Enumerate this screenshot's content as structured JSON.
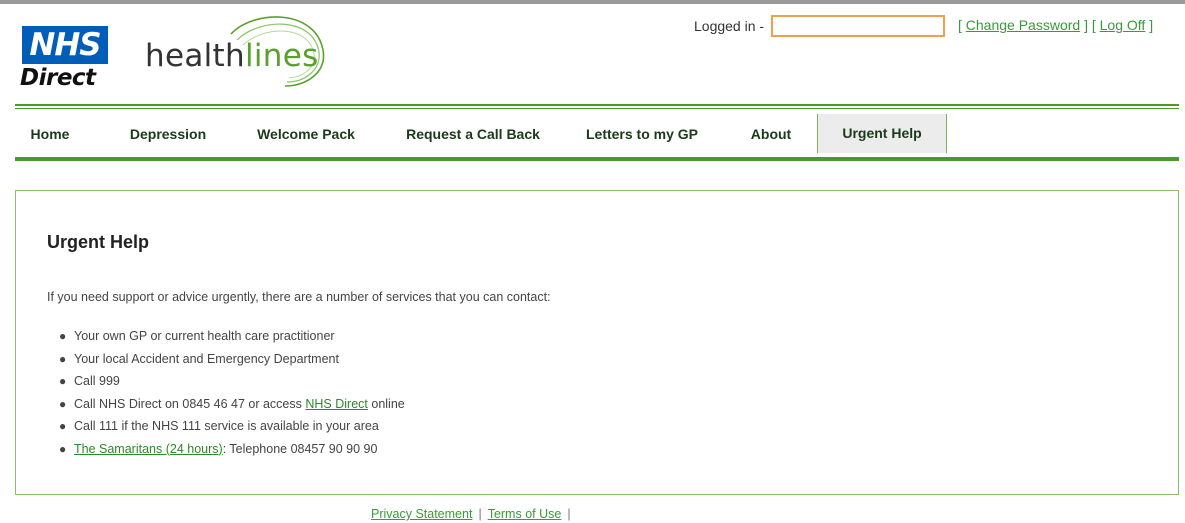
{
  "logo": {
    "nhs_text": "NHS",
    "nhs_sub_text": "Direct",
    "brand_part1": "health",
    "brand_part2": "lines",
    "brand_color": "#005eb8",
    "accent_color": "#5aa02c"
  },
  "header": {
    "logged_in_label": "Logged in -",
    "username_value": "",
    "bracket_open": "[",
    "bracket_close": "]",
    "change_password": "Change Password",
    "log_off": "Log Off"
  },
  "nav": {
    "items": [
      {
        "label": "Home"
      },
      {
        "label": "Depression"
      },
      {
        "label": "Welcome Pack"
      },
      {
        "label": "Request a Call Back"
      },
      {
        "label": "Letters to my GP"
      },
      {
        "label": "About"
      },
      {
        "label": "Urgent Help",
        "active": true
      }
    ]
  },
  "main": {
    "title": "Urgent Help",
    "intro": "If you need support or advice urgently, there are a number of services that you can contact:",
    "services": [
      {
        "text": "Your own GP or current health care practitioner"
      },
      {
        "text": "Your local Accident and Emergency Department"
      },
      {
        "text": "Call 999"
      },
      {
        "before": "Call NHS Direct on 0845 46 47 or access ",
        "link": "NHS Direct",
        "after": " online"
      },
      {
        "text": "Call 111 if the NHS 111 service is available in your area"
      },
      {
        "link": "The Samaritans (24 hours)",
        "after": ": Telephone 08457 90 90 90"
      }
    ]
  },
  "footer": {
    "privacy": "Privacy Statement",
    "terms": "Terms of Use",
    "separator": "|"
  }
}
